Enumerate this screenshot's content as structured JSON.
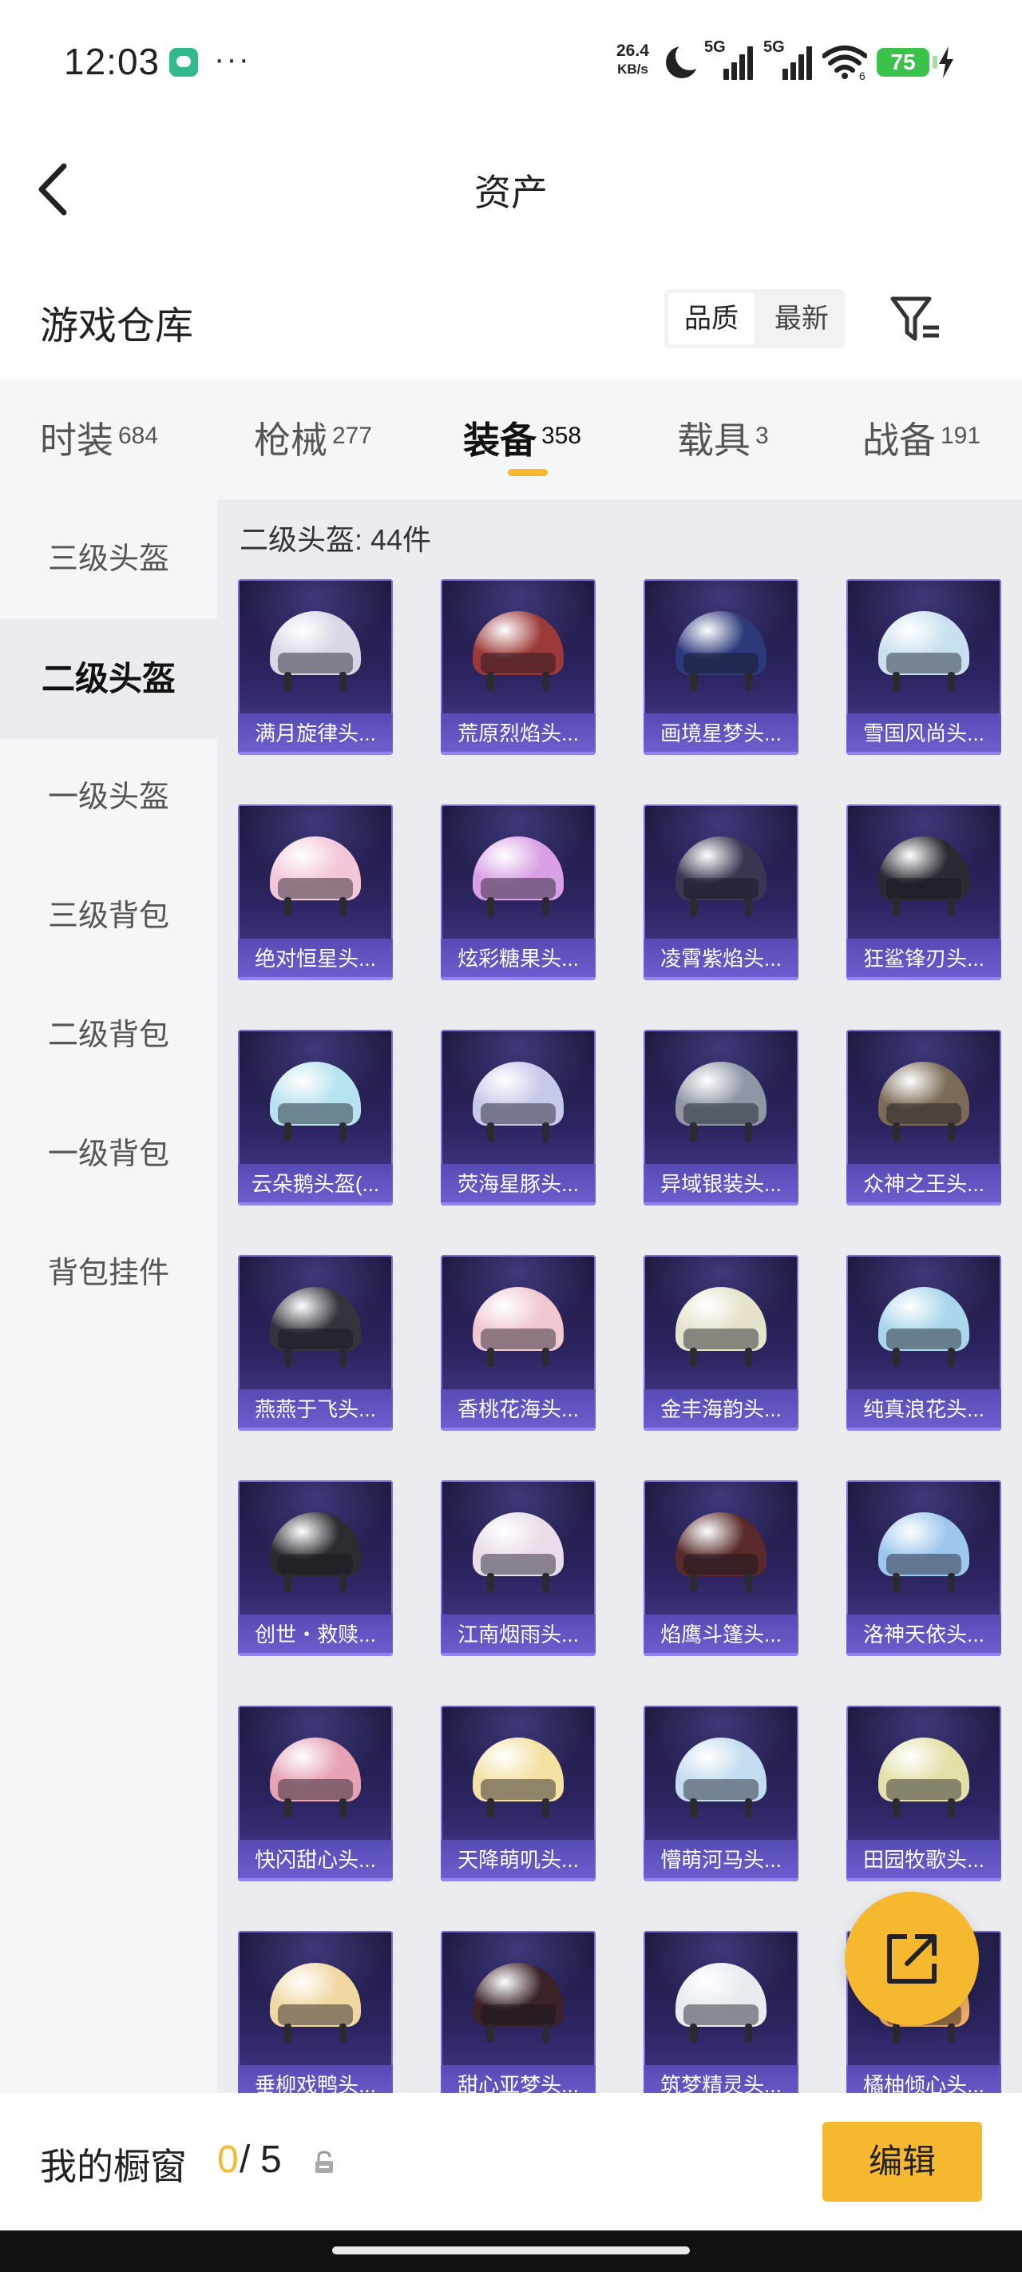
{
  "status_bar": {
    "time": "12:03",
    "more": "···",
    "net_speed_value": "26.4",
    "net_speed_unit": "KB/s",
    "signal_1": "5G",
    "signal_2": "5G",
    "wifi_badge": "6",
    "battery": "75",
    "icons": [
      "wechat-icon",
      "moon-icon",
      "signal-icon",
      "wifi-icon",
      "battery-icon",
      "charging-icon"
    ]
  },
  "header": {
    "title": "资产",
    "back_icon": "chevron-left-icon"
  },
  "warehouse": {
    "title": "游戏仓库",
    "sort_options": [
      "品质",
      "最新"
    ],
    "sort_selected": "品质",
    "filter_icon": "filter-icon"
  },
  "tabs": [
    {
      "label": "时装",
      "count": "684"
    },
    {
      "label": "枪械",
      "count": "277"
    },
    {
      "label": "装备",
      "count": "358",
      "active": true
    },
    {
      "label": "载具",
      "count": "3"
    },
    {
      "label": "战备",
      "count": "191"
    }
  ],
  "accent_color": "#f5b82e",
  "sidebar": {
    "items": [
      {
        "label": "三级头盔"
      },
      {
        "label": "二级头盔",
        "active": true
      },
      {
        "label": "一级头盔"
      },
      {
        "label": "三级背包"
      },
      {
        "label": "二级背包"
      },
      {
        "label": "一级背包"
      },
      {
        "label": "背包挂件"
      }
    ]
  },
  "content": {
    "section_title": "二级头盔: 44件",
    "items": [
      {
        "name": "满月旋律头...",
        "color": "#d9d6e6"
      },
      {
        "name": "荒原烈焰头...",
        "color": "#9c3a3a"
      },
      {
        "name": "画境星梦头...",
        "color": "#2d3a7a"
      },
      {
        "name": "雪国风尚头...",
        "color": "#c9e0ef"
      },
      {
        "name": "绝对恒星头...",
        "color": "#f3c7d9"
      },
      {
        "name": "炫彩糖果头...",
        "color": "#d9a0e6"
      },
      {
        "name": "凌霄紫焰头...",
        "color": "#3a3550"
      },
      {
        "name": "狂鲨锋刃头...",
        "color": "#2a2a32"
      },
      {
        "name": "云朵鹅头盔(...",
        "color": "#b7e2ef"
      },
      {
        "name": "荧海星豚头...",
        "color": "#c7c9ea"
      },
      {
        "name": "异域银装头...",
        "color": "#8f97a6"
      },
      {
        "name": "众神之王头...",
        "color": "#7b6a55"
      },
      {
        "name": "燕燕于飞头...",
        "color": "#34343c"
      },
      {
        "name": "香桃花海头...",
        "color": "#f1c8cf"
      },
      {
        "name": "金丰海韵头...",
        "color": "#e7e2cc"
      },
      {
        "name": "纯真浪花头...",
        "color": "#a9d6ea"
      },
      {
        "name": "创世・救赎...",
        "color": "#2c2c30"
      },
      {
        "name": "江南烟雨头...",
        "color": "#eadde9"
      },
      {
        "name": "焰鹰斗篷头...",
        "color": "#5a2a2a"
      },
      {
        "name": "洛神天依头...",
        "color": "#9ec7ee"
      },
      {
        "name": "快闪甜心头...",
        "color": "#e6a3b5"
      },
      {
        "name": "天降萌叽头...",
        "color": "#f4e1a3"
      },
      {
        "name": "懵萌河马头...",
        "color": "#c3dcef"
      },
      {
        "name": "田园牧歌头...",
        "color": "#e3e0a8"
      },
      {
        "name": "垂柳戏鸭头...",
        "color": "#f1d7a0"
      },
      {
        "name": "甜心亚梦头...",
        "color": "#3a2228"
      },
      {
        "name": "筑梦精灵头...",
        "color": "#e6ecef"
      },
      {
        "name": "橘柚倾心头...",
        "color": "#f0b066"
      }
    ]
  },
  "fab_icon": "share-external-icon",
  "bottom_bar": {
    "label": "我的橱窗",
    "current": "0",
    "separator": "/",
    "max": "5",
    "lock_icon": "lock-icon",
    "edit_label": "编辑"
  }
}
